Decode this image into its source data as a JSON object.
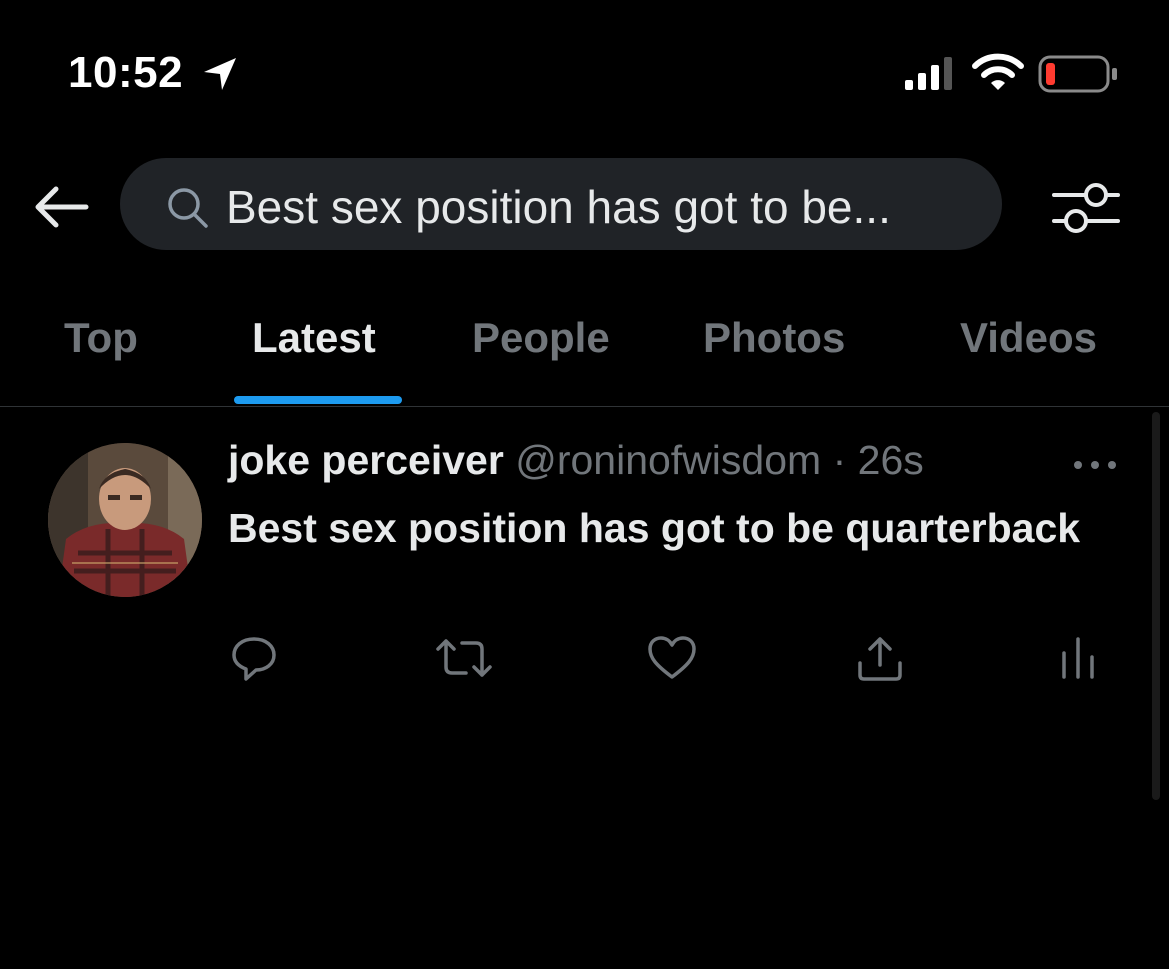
{
  "status_bar": {
    "time": "10:52",
    "icons": [
      "location-arrow-icon",
      "cellular-signal-icon",
      "wifi-icon",
      "battery-low-icon"
    ],
    "battery_color": "#ff3b30"
  },
  "search": {
    "query": "Best sex position has got to be...",
    "icons": [
      "back-arrow-icon",
      "search-icon",
      "filter-sliders-icon"
    ]
  },
  "tabs": [
    {
      "label": "Top"
    },
    {
      "label": "Latest"
    },
    {
      "label": "People"
    },
    {
      "label": "Photos"
    },
    {
      "label": "Videos"
    }
  ],
  "active_tab": "Latest",
  "accent_color": "#1d9bf0",
  "tweet": {
    "author_name": "joke perceiver",
    "handle": "@roninofwisdom",
    "separator": "·",
    "time": "26s",
    "text": "Best sex position has got to be quarterback",
    "actions": [
      "reply-icon",
      "retweet-icon",
      "like-icon",
      "share-icon",
      "analytics-icon"
    ]
  }
}
